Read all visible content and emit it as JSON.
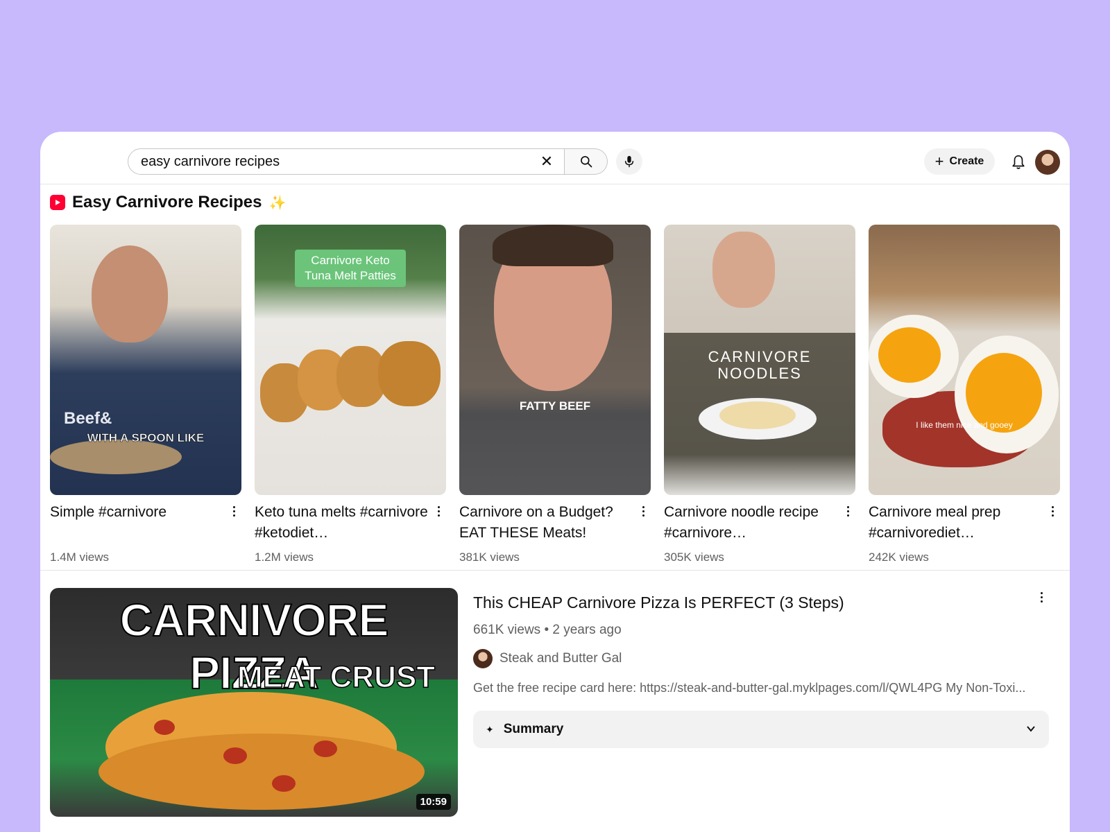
{
  "search": {
    "query": "easy carnivore recipes"
  },
  "header": {
    "create_label": "Create"
  },
  "shelf": {
    "title": "Easy Carnivore Recipes",
    "shorts": [
      {
        "title": "Simple #carnivore",
        "views": "1.4M views",
        "overlay": "WITH A SPOON LIKE",
        "shirt_text": "Beef&"
      },
      {
        "title": "Keto tuna melts #carnivore #ketodiet…",
        "views": "1.2M views",
        "overlay_line1": "Carnivore Keto",
        "overlay_line2": "Tuna Melt Patties"
      },
      {
        "title": "Carnivore on a Budget? EAT THESE Meats!",
        "views": "381K views",
        "overlay": "FATTY BEEF"
      },
      {
        "title": "Carnivore noodle recipe #carnivore…",
        "views": "305K views",
        "overlay_line1": "CARNIVORE",
        "overlay_line2": "NOODLES"
      },
      {
        "title": "Carnivore meal prep #carnivorediet…",
        "views": "242K views",
        "overlay": "I like them nice and gooey"
      }
    ]
  },
  "video": {
    "title": "This CHEAP Carnivore Pizza Is PERFECT (3 Steps)",
    "meta": "661K views • 2 years ago",
    "channel": "Steak and Butter Gal",
    "description": "Get the free recipe card here: https://steak-and-butter-gal.myklpages.com/l/QWL4PG My Non-Toxi...",
    "duration": "10:59",
    "thumb_title": "CARNIVORE PIZZA",
    "thumb_subtitle": "MEAT CRUST",
    "summary_label": "Summary"
  }
}
